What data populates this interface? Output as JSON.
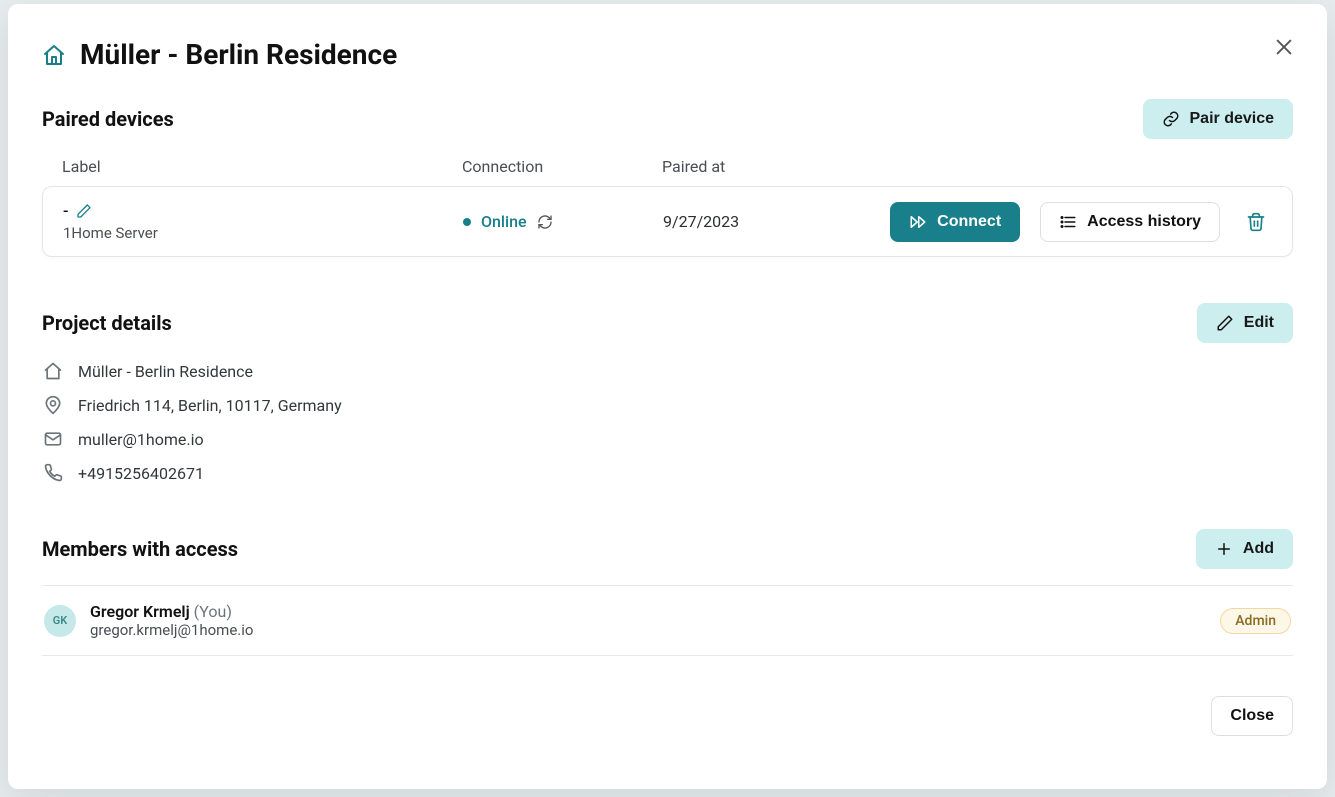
{
  "header": {
    "title": "Müller - Berlin Residence"
  },
  "paired": {
    "section_title": "Paired devices",
    "pair_button": "Pair device",
    "columns": {
      "label": "Label",
      "connection": "Connection",
      "paired_at": "Paired at"
    },
    "row": {
      "label": "-",
      "device_type": "1Home Server",
      "status": "Online",
      "paired_at": "9/27/2023",
      "connect_label": "Connect",
      "history_label": "Access history"
    }
  },
  "details": {
    "section_title": "Project details",
    "edit_button": "Edit",
    "name": "Müller - Berlin Residence",
    "address": "Friedrich 114, Berlin, 10117, Germany",
    "email": "muller@1home.io",
    "phone": "+4915256402671"
  },
  "members": {
    "section_title": "Members with access",
    "add_button": "Add",
    "row": {
      "initials": "GK",
      "name": "Gregor Krmelj",
      "you_suffix": "(You)",
      "email": "gregor.krmelj@1home.io",
      "role": "Admin"
    }
  },
  "footer": {
    "close_button": "Close"
  }
}
